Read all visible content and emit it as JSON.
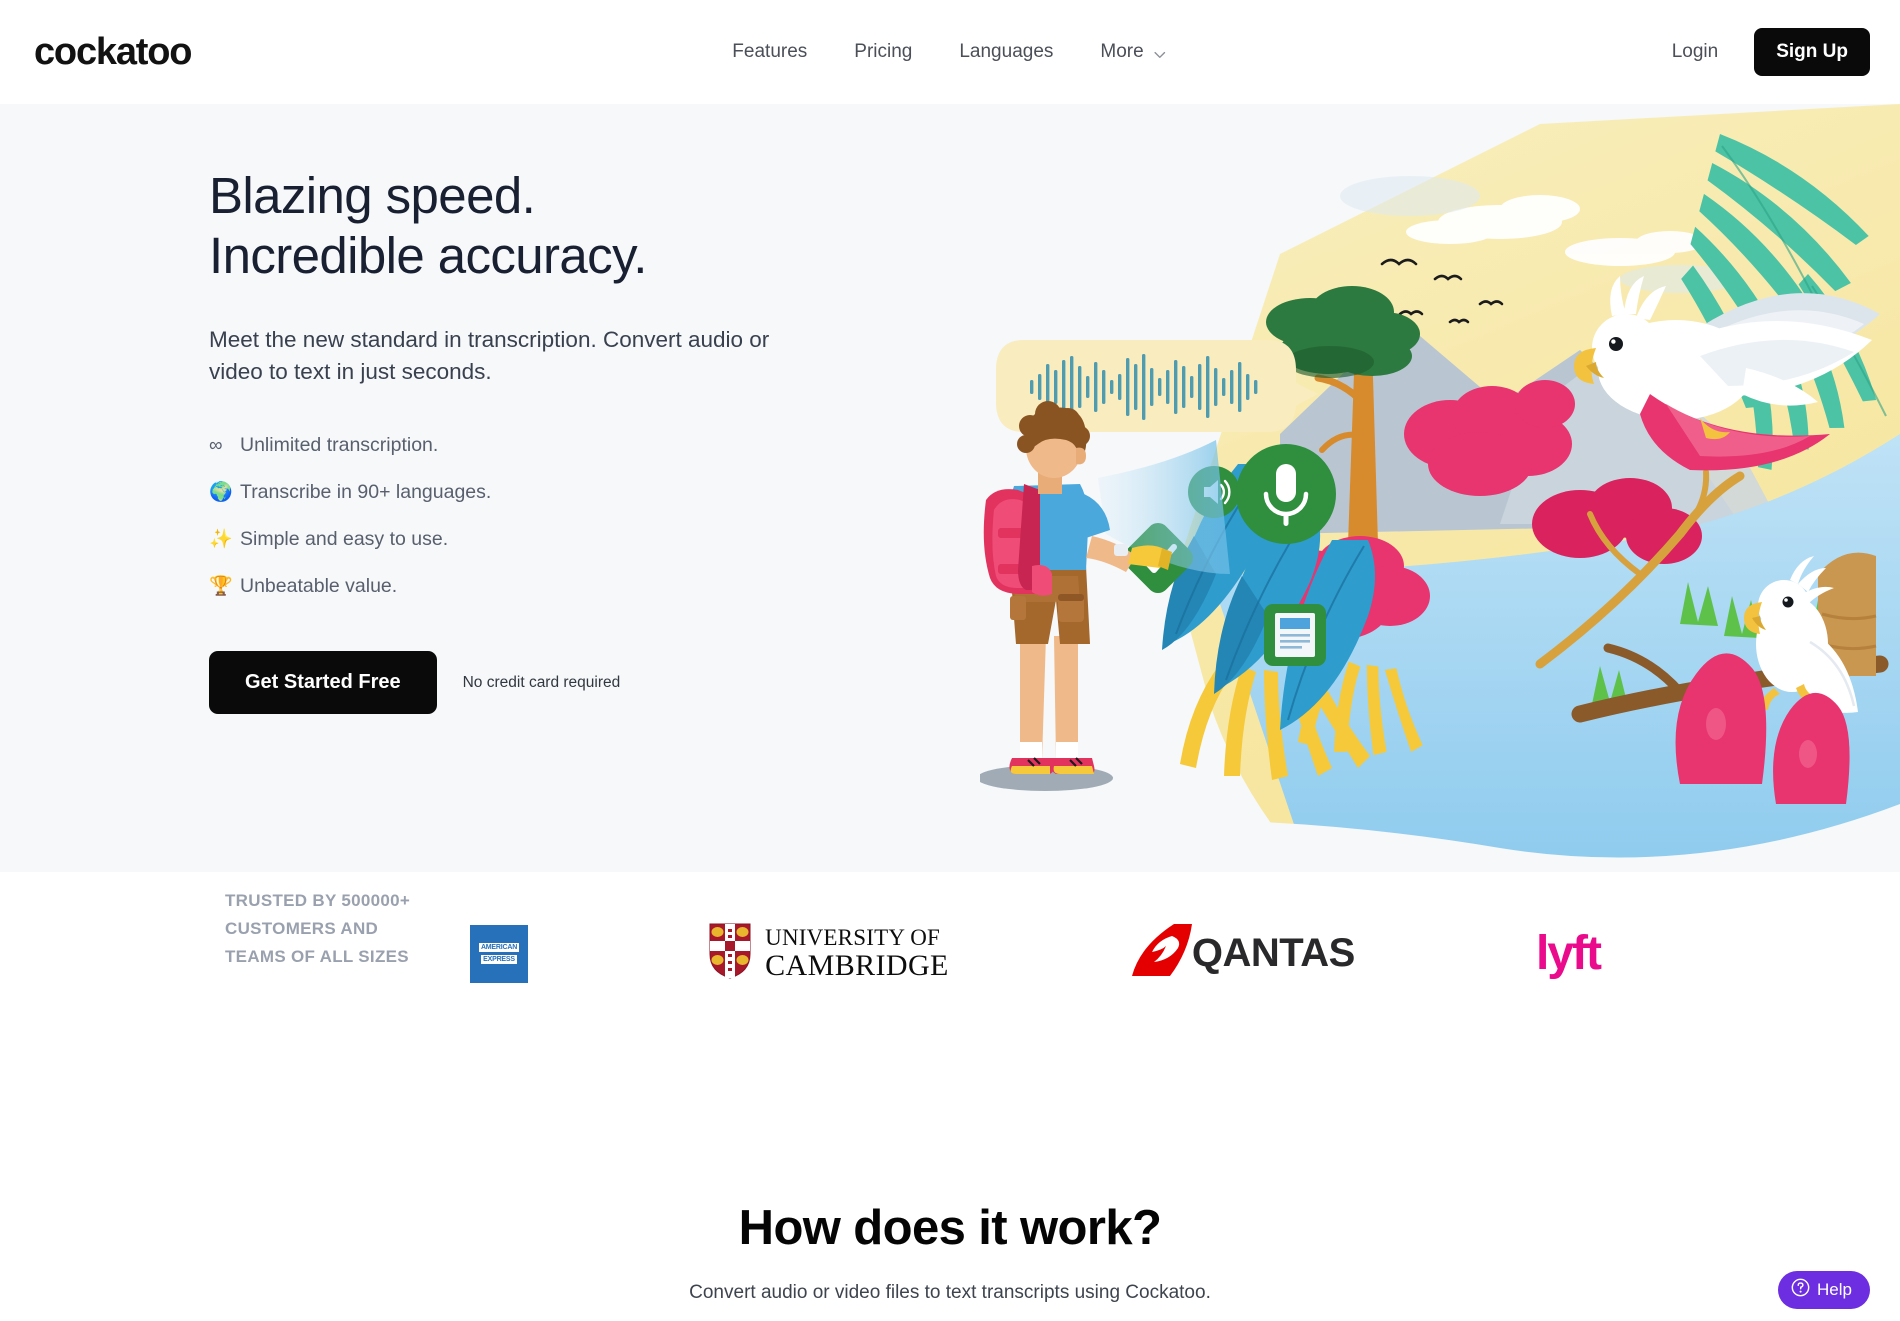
{
  "header": {
    "logo_text": "cockatoo",
    "logo_icon": "cockatoo-wordmark",
    "nav": [
      {
        "label": "Features",
        "icon": null
      },
      {
        "label": "Pricing",
        "icon": null
      },
      {
        "label": "Languages",
        "icon": null
      },
      {
        "label": "More",
        "icon": "chevron-down-icon"
      }
    ],
    "login_label": "Login",
    "signup_label": "Sign Up"
  },
  "hero": {
    "headline_line1": "Blazing speed.",
    "headline_line2": "Incredible accuracy.",
    "subhead": "Meet the new standard in transcription. Convert audio or video to text in just seconds.",
    "features": [
      {
        "emoji": "∞",
        "icon": "infinity-icon",
        "label": "Unlimited transcription."
      },
      {
        "emoji": "🌍",
        "icon": "globe-icon",
        "label": "Transcribe in 90+ languages."
      },
      {
        "emoji": "✨",
        "icon": "sparkles-icon",
        "label": "Simple and easy to use."
      },
      {
        "emoji": "🏆",
        "icon": "trophy-icon",
        "label": "Unbeatable value."
      }
    ],
    "cta_label": "Get Started Free",
    "cta_note": "No credit card required",
    "background_color": "#f6f8fa",
    "illustration": {
      "name": "jungle-cockatoo-illustration",
      "elements": [
        "explorer-with-flashlight",
        "speech-bubble-waveform",
        "flying-cockatoo",
        "perched-cockatoo",
        "microphone-icon",
        "speaker-icon",
        "checkmark-icon",
        "transcript-document-icon",
        "palm-fronds",
        "mountains",
        "birds-in-sky"
      ],
      "colors": {
        "sky": "#f6e7a8",
        "mountain": "#b9c6d2",
        "palm": "#4cc3a5",
        "water_blue": "#9fd2ef",
        "leaf_blue": "#2e9ccd",
        "flower_pink": "#e8346f",
        "flower_yellow": "#f5c93a",
        "bubble": "#f9ecbf",
        "waveform": "#4f9bb0",
        "icon_green": "#2f8f3f"
      }
    }
  },
  "trusted": {
    "label": "TRUSTED BY 500000+ CUSTOMERS AND TEAMS OF ALL SIZES",
    "logos": [
      {
        "name": "american-express-logo",
        "line1": "AMERICAN",
        "line2": "EXPRESS",
        "color": "#2671b9"
      },
      {
        "name": "university-of-cambridge-logo",
        "line1": "UNIVERSITY OF",
        "line2": "CAMBRIDGE",
        "color": "#0d0d0d"
      },
      {
        "name": "qantas-logo",
        "line1": "QANTAS",
        "line2": "",
        "color": "#e40000"
      },
      {
        "name": "lyft-logo",
        "line1": "lyft",
        "line2": "",
        "color": "#ea0b8c"
      }
    ]
  },
  "how_it_works": {
    "title": "How does it work?",
    "subtitle": "Convert audio or video files to text transcripts using Cockatoo."
  },
  "help_widget": {
    "label": "Help",
    "icon": "question-circle-icon",
    "color": "#6c2ee0"
  }
}
